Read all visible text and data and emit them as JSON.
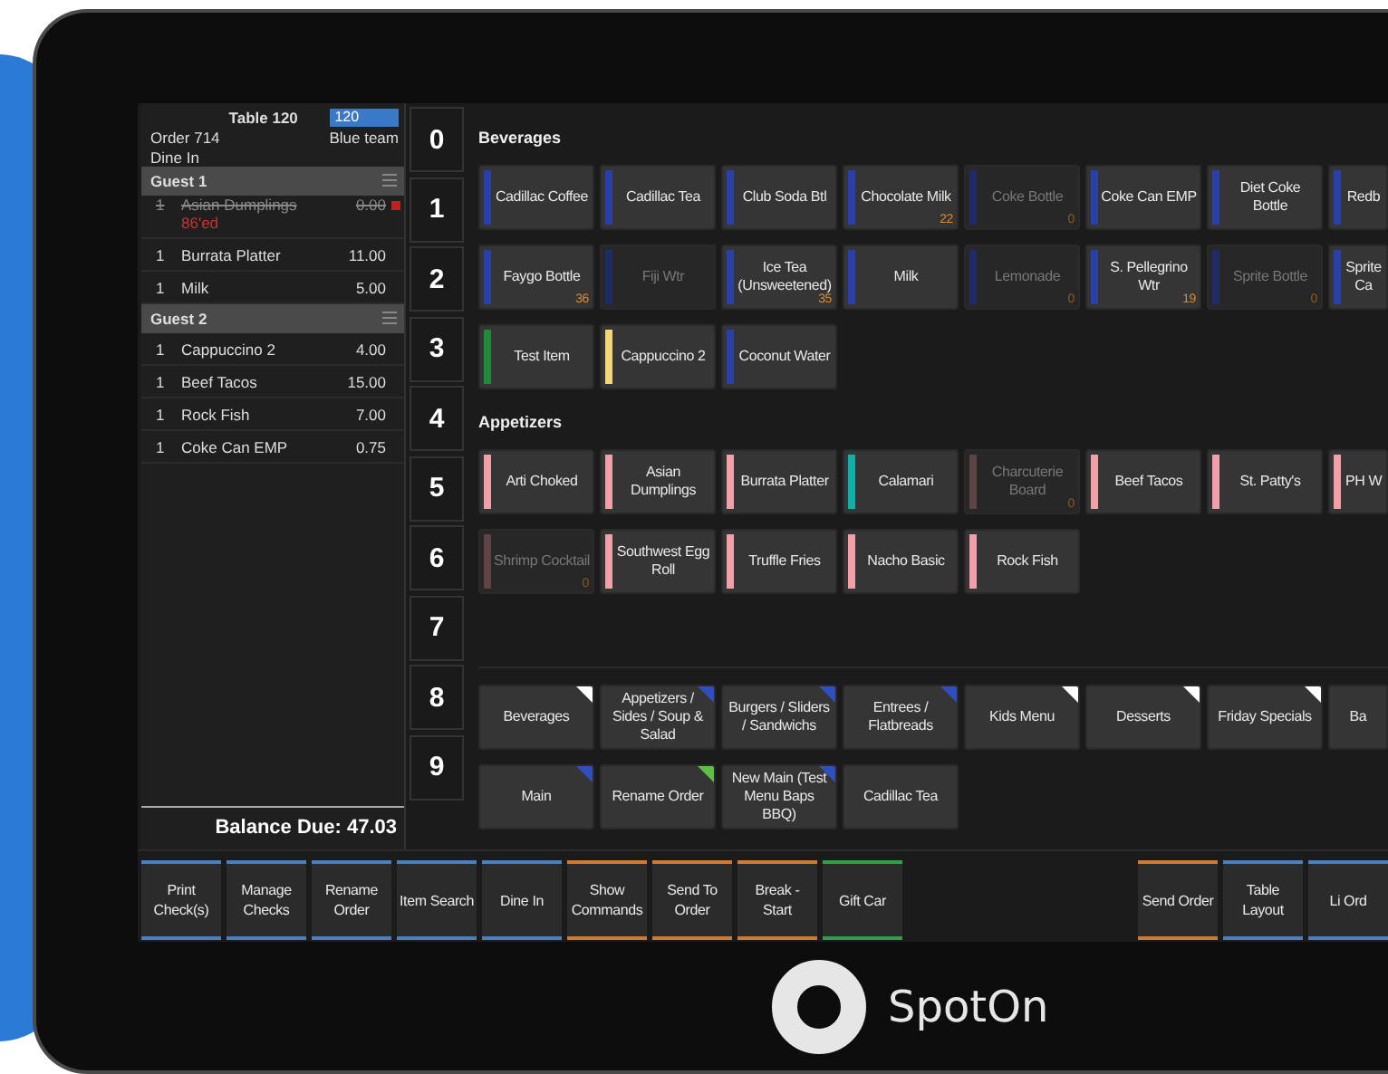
{
  "order_panel": {
    "table": "Table 120",
    "badge": "120",
    "order": "Order 714",
    "team": "Blue team",
    "mode": "Dine In",
    "guests": [
      {
        "name": "Guest 1",
        "items": [
          {
            "qty": "1",
            "name": "Asian Dumplings",
            "price": "0.00",
            "voided": true,
            "note": "86'ed"
          },
          {
            "qty": "1",
            "name": "Burrata Platter",
            "price": "11.00",
            "voided": false
          },
          {
            "qty": "1",
            "name": "Milk",
            "price": "5.00",
            "voided": false
          }
        ]
      },
      {
        "name": "Guest 2",
        "items": [
          {
            "qty": "1",
            "name": "Cappuccino 2",
            "price": "4.00",
            "voided": false
          },
          {
            "qty": "1",
            "name": "Beef Tacos",
            "price": "15.00",
            "voided": false
          },
          {
            "qty": "1",
            "name": "Rock Fish",
            "price": "7.00",
            "voided": false
          },
          {
            "qty": "1",
            "name": "Coke Can EMP",
            "price": "0.75",
            "voided": false
          }
        ]
      }
    ],
    "balance": "Balance Due: 47.03"
  },
  "seat_numbers": [
    "0",
    "1",
    "2",
    "3",
    "4",
    "5",
    "6",
    "7",
    "8",
    "9"
  ],
  "menu": {
    "sections": [
      {
        "title": "Beverages",
        "items": [
          {
            "label": "Cadillac Coffee",
            "color": "#2b3fa8",
            "disabled": false
          },
          {
            "label": "Cadillac Tea",
            "color": "#2b3fa8",
            "disabled": false
          },
          {
            "label": "Club Soda Btl",
            "color": "#2b3fa8",
            "disabled": false
          },
          {
            "label": "Chocolate Milk",
            "color": "#2b3fa8",
            "disabled": false,
            "count": "22"
          },
          {
            "label": "Coke Bottle",
            "color": "#1f2b66",
            "disabled": true,
            "count": "0"
          },
          {
            "label": "Coke Can EMP",
            "color": "#2b3fa8",
            "disabled": false
          },
          {
            "label": "Diet Coke Bottle",
            "color": "#2b3fa8",
            "disabled": false
          },
          {
            "label": "Redb",
            "color": "#2b3fa8",
            "disabled": false
          },
          {
            "label": "Faygo Bottle",
            "color": "#2b3fa8",
            "disabled": false,
            "count": "36"
          },
          {
            "label": "Fiji Wtr",
            "color": "#1f2b66",
            "disabled": true
          },
          {
            "label": "Ice Tea (Unsweetened)",
            "color": "#2b3fa8",
            "disabled": false,
            "count": "35"
          },
          {
            "label": "Milk",
            "color": "#2b3fa8",
            "disabled": false
          },
          {
            "label": "Lemonade",
            "color": "#1f2b66",
            "disabled": true,
            "count": "0"
          },
          {
            "label": "S. Pellegrino Wtr",
            "color": "#2b3fa8",
            "disabled": false,
            "count": "19"
          },
          {
            "label": "Sprite Bottle",
            "color": "#1f2b66",
            "disabled": true,
            "count": "0"
          },
          {
            "label": "Sprite Ca",
            "color": "#2b3fa8",
            "disabled": false
          },
          {
            "label": "Test Item",
            "color": "#1e8a3a",
            "disabled": false
          },
          {
            "label": "Cappuccino 2",
            "color": "#f0d878",
            "disabled": false
          },
          {
            "label": "Coconut Water",
            "color": "#2b3fa8",
            "disabled": false
          }
        ]
      },
      {
        "title": "Appetizers",
        "items": [
          {
            "label": "Arti Choked",
            "color": "#f0a0a8",
            "disabled": false
          },
          {
            "label": "Asian Dumplings",
            "color": "#f0a0a8",
            "disabled": false
          },
          {
            "label": "Burrata Platter",
            "color": "#f0a0a8",
            "disabled": false
          },
          {
            "label": "Calamari",
            "color": "#10b0a8",
            "disabled": false
          },
          {
            "label": "Charcuterie Board",
            "color": "#5e4444",
            "disabled": true,
            "count": "0"
          },
          {
            "label": "Beef Tacos",
            "color": "#f0a0a8",
            "disabled": false
          },
          {
            "label": "St. Patty's",
            "color": "#f0a0a8",
            "disabled": false
          },
          {
            "label": "PH W",
            "color": "#f0a0a8",
            "disabled": false
          },
          {
            "label": "Shrimp Cocktail",
            "color": "#5e4444",
            "disabled": true,
            "count": "0"
          },
          {
            "label": "Southwest Egg Roll",
            "color": "#f0a0a8",
            "disabled": false
          },
          {
            "label": "Truffle Fries",
            "color": "#f0a0a8",
            "disabled": false
          },
          {
            "label": "Nacho Basic",
            "color": "#f0a0a8",
            "disabled": false
          },
          {
            "label": "Rock Fish",
            "color": "#f0a0a8",
            "disabled": false
          }
        ]
      }
    ],
    "categories": [
      {
        "label": "Beverages",
        "color": "#ffffff"
      },
      {
        "label": "Appetizers / Sides / Soup & Salad",
        "color": "#2f4fc0"
      },
      {
        "label": "Burgers / Sliders / Sandwichs",
        "color": "#2f4fc0"
      },
      {
        "label": "Entrees / Flatbreads",
        "color": "#2f4fc0"
      },
      {
        "label": "Kids Menu",
        "color": "#ffffff"
      },
      {
        "label": "Desserts",
        "color": "#ffffff"
      },
      {
        "label": "Friday Specials",
        "color": "#ffffff"
      },
      {
        "label": "Ba"
      },
      {
        "label": "Main",
        "color": "#2f4fc0"
      },
      {
        "label": "Rename Order",
        "color": "#5cc040"
      },
      {
        "label": "New Main (Test Menu Baps BBQ)",
        "color": "#2f4fc0"
      },
      {
        "label": "Cadillac Tea"
      }
    ]
  },
  "action_bar": {
    "left": [
      {
        "label": "Print Check(s)",
        "color": "#4a7fc0"
      },
      {
        "label": "Manage Checks",
        "color": "#4a7fc0"
      },
      {
        "label": "Rename Order",
        "color": "#4a7fc0"
      },
      {
        "label": "Item Search",
        "color": "#4a7fc0"
      },
      {
        "label": "Dine In",
        "color": "#4a7fc0"
      },
      {
        "label": "Show Commands",
        "color": "#d07a30"
      },
      {
        "label": "Send To Order",
        "color": "#d07a30"
      },
      {
        "label": "Break - Start",
        "color": "#d07a30"
      },
      {
        "label": "Gift Car",
        "color": "#2ea04a"
      }
    ],
    "right": [
      {
        "label": "Send Order",
        "color": "#d07a30"
      },
      {
        "label": "Table Layout",
        "color": "#4a7fc0"
      },
      {
        "label": "Li Ord",
        "color": "#4a7fc0"
      }
    ]
  },
  "brand": {
    "name": "SpotOn"
  }
}
